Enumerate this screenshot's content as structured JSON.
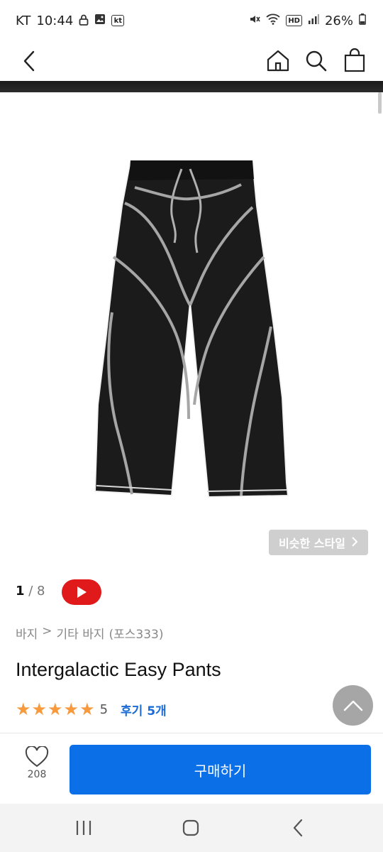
{
  "status_bar": {
    "carrier": "KT",
    "time": "10:44",
    "left_icons": [
      "lock-icon",
      "gallery-icon",
      "kt-icon"
    ],
    "kt_badge": "kt",
    "hd_badge": "HD",
    "battery": "26%",
    "right_icons": [
      "mute-icon",
      "wifi-icon",
      "hd-icon",
      "signal-icon",
      "battery-icon"
    ]
  },
  "header": {
    "icons": [
      "back-icon",
      "home-icon",
      "search-icon",
      "shopping-bag-icon"
    ]
  },
  "product": {
    "image_pager": {
      "current": "1",
      "separator": " / ",
      "total": "8"
    },
    "similar_style_label": "비슷한 스타일",
    "breadcrumb": [
      "바지",
      ">",
      "기타 바지",
      "(포스333)"
    ],
    "title": "Intergalactic Easy Pants",
    "rating": {
      "stars": 5,
      "value": "5"
    },
    "review_label": "후기 5개"
  },
  "bottom_bar": {
    "like_count": "208",
    "buy_label": "구매하기"
  },
  "colors": {
    "accent": "#0b6fe8",
    "star": "#f79a3e",
    "review_link": "#1a6bd6",
    "youtube": "#e01a1a",
    "similar_button": "#cfcfcf"
  },
  "nav_bar": {
    "icons": [
      "recent-apps-icon",
      "home-nav-icon",
      "back-nav-icon"
    ]
  }
}
